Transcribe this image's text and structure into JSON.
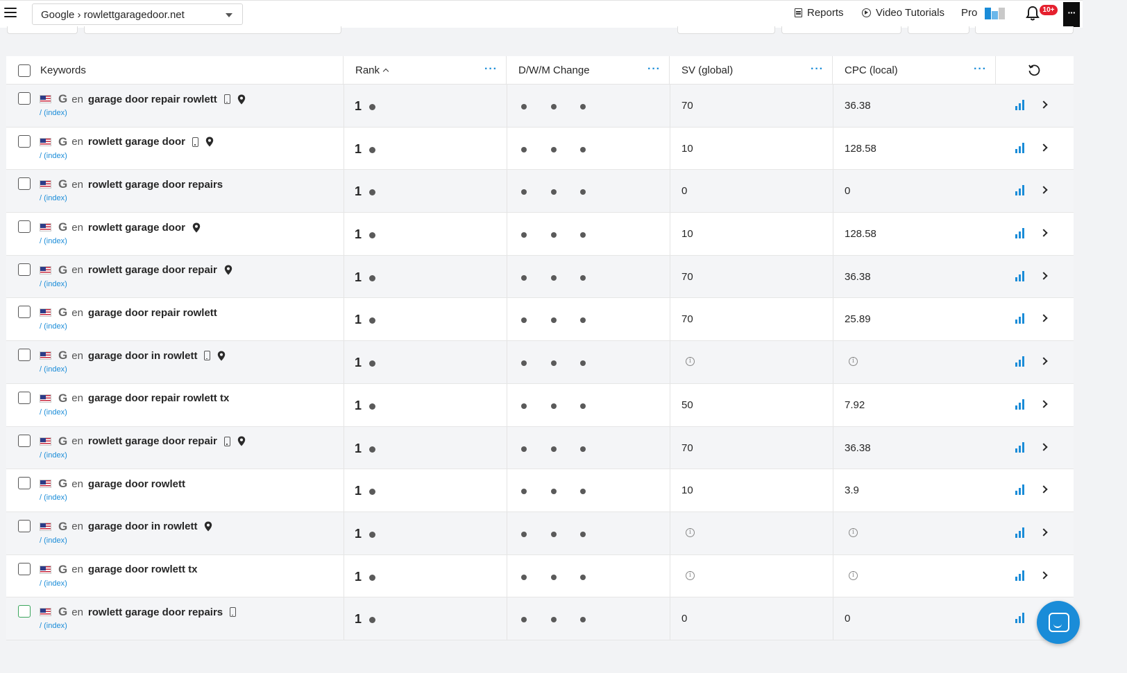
{
  "topbar": {
    "project_selector": "Google › rowlettgaragedoor.net",
    "reports": "Reports",
    "video_tutorials": "Video Tutorials",
    "pro": "Pro",
    "notification_badge": "10+",
    "more": "···"
  },
  "table": {
    "headers": {
      "keywords": "Keywords",
      "rank": "Rank",
      "change": "D/W/M Change",
      "sv": "SV (global)",
      "cpc": "CPC (local)",
      "menu_dots": "···"
    },
    "rows": [
      {
        "lang": "en",
        "keyword": "garage door repair rowlett",
        "mobile": true,
        "local": true,
        "url": "/ (index)",
        "rank": "1",
        "sv": "70",
        "cpc": "36.38"
      },
      {
        "lang": "en",
        "keyword": "rowlett garage door",
        "mobile": true,
        "local": true,
        "url": "/ (index)",
        "rank": "1",
        "sv": "10",
        "cpc": "128.58"
      },
      {
        "lang": "en",
        "keyword": "rowlett garage door repairs",
        "mobile": false,
        "local": false,
        "url": "/ (index)",
        "rank": "1",
        "sv": "0",
        "cpc": "0"
      },
      {
        "lang": "en",
        "keyword": "rowlett garage door",
        "mobile": false,
        "local": true,
        "url": "/ (index)",
        "rank": "1",
        "sv": "10",
        "cpc": "128.58"
      },
      {
        "lang": "en",
        "keyword": "rowlett garage door repair",
        "mobile": false,
        "local": true,
        "url": "/ (index)",
        "rank": "1",
        "sv": "70",
        "cpc": "36.38"
      },
      {
        "lang": "en",
        "keyword": "garage door repair rowlett",
        "mobile": false,
        "local": false,
        "url": "/ (index)",
        "rank": "1",
        "sv": "70",
        "cpc": "25.89"
      },
      {
        "lang": "en",
        "keyword": "garage door in rowlett",
        "mobile": true,
        "local": true,
        "url": "/ (index)",
        "rank": "1",
        "sv": null,
        "cpc": null
      },
      {
        "lang": "en",
        "keyword": "garage door repair rowlett tx",
        "mobile": false,
        "local": false,
        "url": "/ (index)",
        "rank": "1",
        "sv": "50",
        "cpc": "7.92"
      },
      {
        "lang": "en",
        "keyword": "rowlett garage door repair",
        "mobile": true,
        "local": true,
        "url": "/ (index)",
        "rank": "1",
        "sv": "70",
        "cpc": "36.38"
      },
      {
        "lang": "en",
        "keyword": "garage door rowlett",
        "mobile": false,
        "local": false,
        "url": "/ (index)",
        "rank": "1",
        "sv": "10",
        "cpc": "3.9"
      },
      {
        "lang": "en",
        "keyword": "garage door in rowlett",
        "mobile": false,
        "local": true,
        "url": "/ (index)",
        "rank": "1",
        "sv": null,
        "cpc": null
      },
      {
        "lang": "en",
        "keyword": "garage door rowlett tx",
        "mobile": false,
        "local": false,
        "url": "/ (index)",
        "rank": "1",
        "sv": null,
        "cpc": null
      },
      {
        "lang": "en",
        "keyword": "rowlett garage door repairs",
        "mobile": true,
        "local": false,
        "url": "/ (index)",
        "rank": "1",
        "sv": "0",
        "cpc": "0"
      }
    ]
  },
  "colors": {
    "accent": "#1a8cd8",
    "badge": "#e5202e",
    "dot": "#5a5a5a"
  },
  "icons": [
    "menu-icon",
    "caret-down-icon",
    "reports-icon",
    "video-icon",
    "pro-logo-icon",
    "bell-icon",
    "refresh-icon",
    "sort-up-icon",
    "us-flag-icon",
    "google-icon",
    "mobile-icon",
    "location-pin-icon",
    "info-icon",
    "bar-chart-icon",
    "chevron-right-icon",
    "chat-icon"
  ]
}
